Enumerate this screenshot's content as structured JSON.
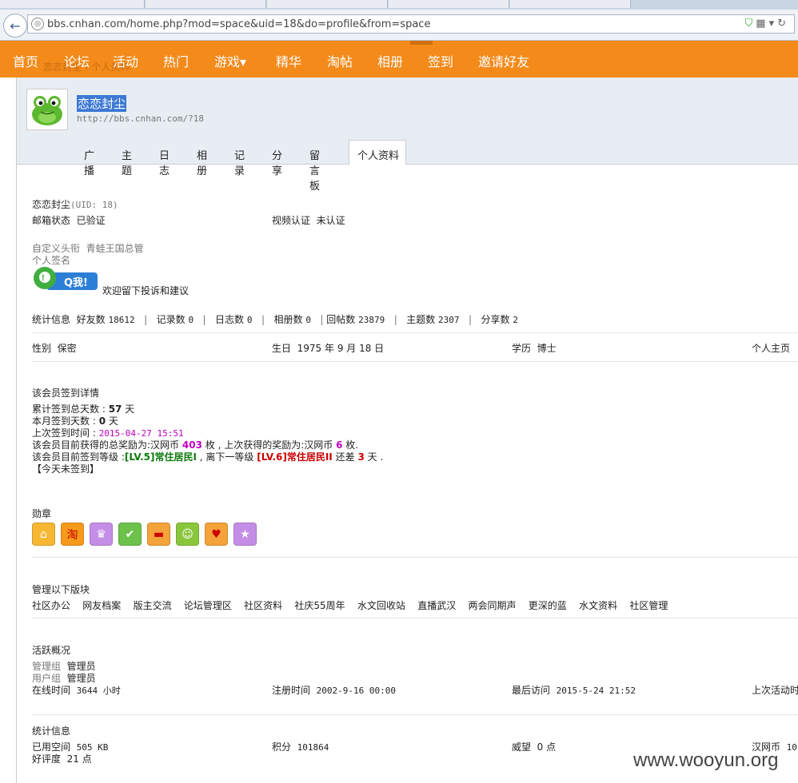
{
  "browser": {
    "url": "bbs.cnhan.com/home.php?mod=space&uid=18&do=profile&from=space"
  },
  "nav": {
    "items": [
      "首页",
      "论坛",
      "活动",
      "热门",
      "游戏▾",
      "精华",
      "淘帖",
      "相册",
      "签到",
      "邀请好友"
    ],
    "ghost": "恋恋封尘 › 个人资料"
  },
  "header": {
    "username": "恋恋封尘",
    "link": "http://bbs.cnhan.com/?18",
    "tabs": [
      "广播",
      "主题",
      "日志",
      "相册",
      "记录",
      "分享",
      "留言板"
    ],
    "active_tab": "个人资料"
  },
  "profile": {
    "name": "恋恋封尘",
    "uid": "(UID: 18)",
    "email_label": "邮箱状态",
    "email_value": "已验证",
    "video_label": "视频认证",
    "video_value": "未认证",
    "title_label": "自定义头衔",
    "title_value": "青蛙王国总管",
    "sign_label": "个人签名",
    "qq_text": "Q我!",
    "sign_text": "欢迎留下投诉和建议"
  },
  "stats_line": {
    "label": "统计信息",
    "items": [
      {
        "k": "好友数",
        "v": "18612"
      },
      {
        "k": "记录数",
        "v": "0"
      },
      {
        "k": "日志数",
        "v": "0"
      },
      {
        "k": "相册数",
        "v": "0"
      },
      {
        "k": "回帖数",
        "v": "23879"
      },
      {
        "k": "主题数",
        "v": "2307"
      },
      {
        "k": "分享数",
        "v": "2"
      }
    ]
  },
  "basic": {
    "gender_label": "性别",
    "gender": "保密",
    "birth_label": "生日",
    "birth": "1975 年 9 月 18 日",
    "edu_label": "学历",
    "edu": "博士",
    "home_label": "个人主页"
  },
  "checkin": {
    "title": "该会员签到详情",
    "total_label": "累计签到总天数 :",
    "total": "57",
    "day": "天",
    "month_label": "本月签到天数 :",
    "month": "0",
    "last_label": "上次签到时间 :",
    "last": "2015-04-27 15:51",
    "reward_a": "该会员目前获得的总奖励为:汉网币",
    "reward_total": "403",
    "reward_b": "枚 , 上次获得的奖励为:汉网币",
    "reward_last": "6",
    "reward_c": "枚.",
    "level_a": "该会员目前签到等级 :",
    "level_cur": "[LV.5]常住居民I",
    "level_b": ", 离下一等级",
    "level_next": "[LV.6]常住居民II",
    "level_c": "还差",
    "level_gap": "3",
    "level_d": "天 .",
    "today": "【今天未签到】"
  },
  "medals": {
    "title": "勋章",
    "items": [
      {
        "icon": "house-icon",
        "glyph": "⌂",
        "color": "#f7b733"
      },
      {
        "icon": "taobao-icon",
        "glyph": "淘",
        "color": "#f59a1b"
      },
      {
        "icon": "crown-icon",
        "glyph": "♛",
        "color": "#c58ee6"
      },
      {
        "icon": "check-icon",
        "glyph": "✔",
        "color": "#6cc24a"
      },
      {
        "icon": "sofa-icon",
        "glyph": "▬",
        "color": "#f4a23a"
      },
      {
        "icon": "smile-icon",
        "glyph": "☺",
        "color": "#8ac63c"
      },
      {
        "icon": "heart-icon",
        "glyph": "♥",
        "color": "#f4a23a"
      },
      {
        "icon": "star-icon",
        "glyph": "★",
        "color": "#c58ee6"
      }
    ]
  },
  "forums": {
    "title": "管理以下版块",
    "items": [
      "社区办公",
      "网友档案",
      "版主交流",
      "论坛管理区",
      "社区资料",
      "社庆55周年",
      "水文回收站",
      "直播武汉",
      "两会同期声",
      "更深的蓝",
      "水文资料",
      "社区管理"
    ]
  },
  "activity": {
    "title": "活跃概况",
    "admin_label": "管理组",
    "admin": "管理员",
    "user_label": "用户组",
    "user": "管理员",
    "online_label": "在线时间",
    "online": "3644 小时",
    "reg_label": "注册时间",
    "reg": "2002-9-16 00:00",
    "visit_label": "最后访问",
    "visit": "2015-5-24 21:52",
    "lastact_label": "上次活动时"
  },
  "statistics": {
    "title": "统计信息",
    "space_label": "已用空间",
    "space": "505 KB",
    "credit_label": "积分",
    "credit": "101864",
    "prestige_label": "威望",
    "prestige": "0 点",
    "coin_label": "汉网币",
    "coin": "10",
    "rating_label": "好评度",
    "rating": "21 点"
  },
  "watermark": "www.wooyun.org"
}
